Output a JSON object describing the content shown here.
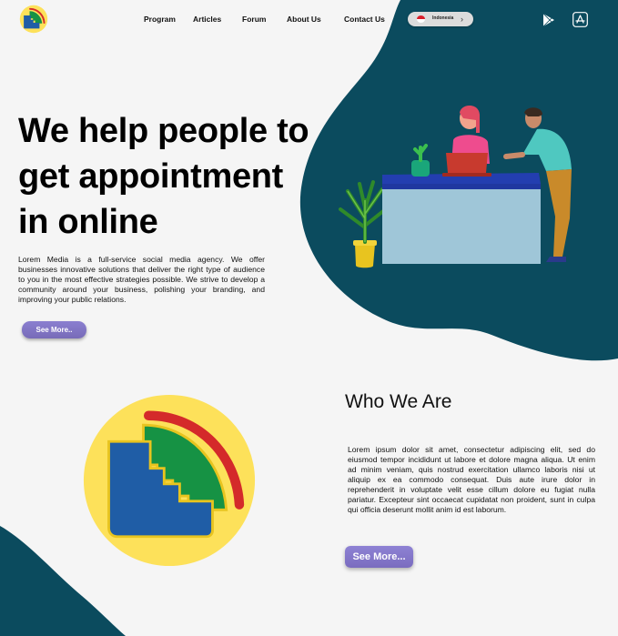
{
  "nav": {
    "items": [
      {
        "label": "Program"
      },
      {
        "label": "Articles"
      },
      {
        "label": "Forum"
      },
      {
        "label": "About Us"
      },
      {
        "label": "Contact Us"
      }
    ],
    "language": "Indonesia",
    "language_chevron": "›"
  },
  "hero": {
    "title": "We help people to get appointment in online",
    "description": "Lorem Media is a full-service social media agency. We offer businesses innovative solutions that deliver the right type of audience to you in the most effective strategies possible. We strive to develop a community around your business, polishing your branding, and improving your public relations.",
    "button_label": "See More.."
  },
  "about": {
    "title": "Who We Are",
    "description": "Lorem ipsum dolor sit amet, consectetur adipiscing elit, sed do eiusmod tempor incididunt ut labore et dolore magna aliqua. Ut enim ad minim veniam, quis nostrud exercitation ullamco laboris nisi ut aliquip ex ea commodo consequat. Duis aute irure dolor in reprehenderit in voluptate velit esse cillum dolore eu fugiat nulla pariatur. Excepteur sint occaecat cupidatat non proident, sunt in culpa qui officia deserunt mollit anim id est laborum.",
    "button_label": "See More..."
  },
  "icons": {
    "logo": "brand-logo",
    "play_store": "google-play-icon",
    "app_store": "app-store-icon"
  },
  "colors": {
    "background": "#f5f5f5",
    "teal": "#0b4b5e",
    "button_purple": "#8075c6",
    "logo_yellow": "#fde15a",
    "logo_blue": "#1f5da6",
    "logo_green": "#169244",
    "logo_red": "#d42a2a"
  }
}
